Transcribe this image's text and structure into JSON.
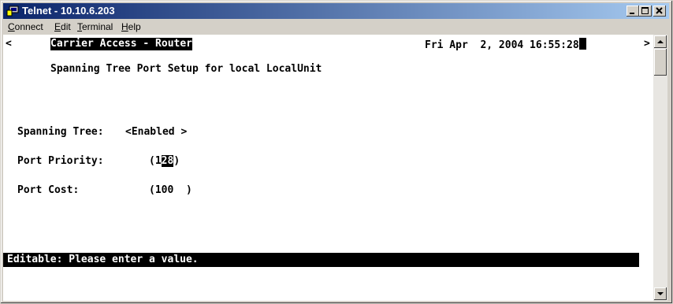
{
  "window": {
    "title": "Telnet - 10.10.6.203"
  },
  "menu": {
    "connect": {
      "first": "C",
      "rest": "onnect"
    },
    "edit": {
      "first": "E",
      "rest": "dit"
    },
    "terminal": {
      "first": "T",
      "rest": "erminal"
    },
    "help": {
      "first": "H",
      "rest": "elp"
    }
  },
  "screen": {
    "left_marker": "<",
    "right_marker": ">",
    "header_title": "Carrier Access - Router",
    "datetime": "Fri Apr  2, 2004 16:55:28",
    "page_title": "Spanning Tree Port Setup for local LocalUnit",
    "fields": {
      "spanning_tree": {
        "label": "Spanning Tree:",
        "value": "<Enabled >"
      },
      "port_priority": {
        "label": "Port Priority:",
        "prefix": "(1",
        "selected": "28",
        "suffix": ")"
      },
      "port_cost": {
        "label": "Port Cost:",
        "value": "(100  )"
      }
    },
    "status_message": "Editable: Please enter a value."
  },
  "colors": {
    "titlebar_start": "#0a246a",
    "titlebar_end": "#a6caf0",
    "chrome": "#d4d0c8",
    "terminal_bg": "#ffffff",
    "terminal_fg": "#000000"
  }
}
